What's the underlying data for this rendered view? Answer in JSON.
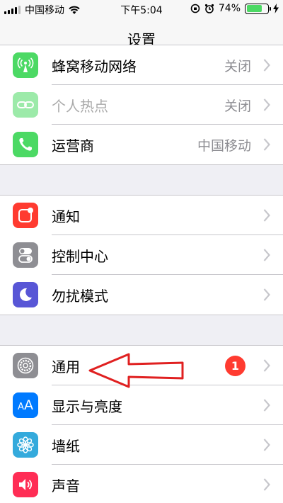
{
  "status_bar": {
    "carrier": "中国移动",
    "time": "下午5:04",
    "battery_percent": "74%",
    "battery_level": 0.74
  },
  "nav": {
    "title": "设置"
  },
  "groups": [
    {
      "rows": [
        {
          "label": "蜂窝移动网络",
          "value": "关闭",
          "icon": "antenna-icon",
          "color": "#4cd964"
        },
        {
          "label": "个人热点",
          "value": "关闭",
          "icon": "hotspot-icon",
          "color": "#4cd964",
          "disabled": true
        },
        {
          "label": "运营商",
          "value": "中国移动",
          "icon": "phone-icon",
          "color": "#4cd964"
        }
      ]
    },
    {
      "rows": [
        {
          "label": "通知",
          "icon": "notifications-icon",
          "color": "#ff3b30"
        },
        {
          "label": "控制中心",
          "icon": "switches-icon",
          "color": "#8e8e93"
        },
        {
          "label": "勿扰模式",
          "icon": "moon-icon",
          "color": "#5856d6"
        }
      ]
    },
    {
      "rows": [
        {
          "label": "通用",
          "badge": "1",
          "icon": "gear-icon",
          "color": "#8e8e93"
        },
        {
          "label": "显示与亮度",
          "icon": "text-size-icon",
          "color": "#007aff"
        },
        {
          "label": "墙纸",
          "icon": "flower-icon",
          "color": "#34aadc"
        },
        {
          "label": "声音",
          "icon": "speaker-icon",
          "color": "#ff2d55"
        }
      ]
    }
  ]
}
